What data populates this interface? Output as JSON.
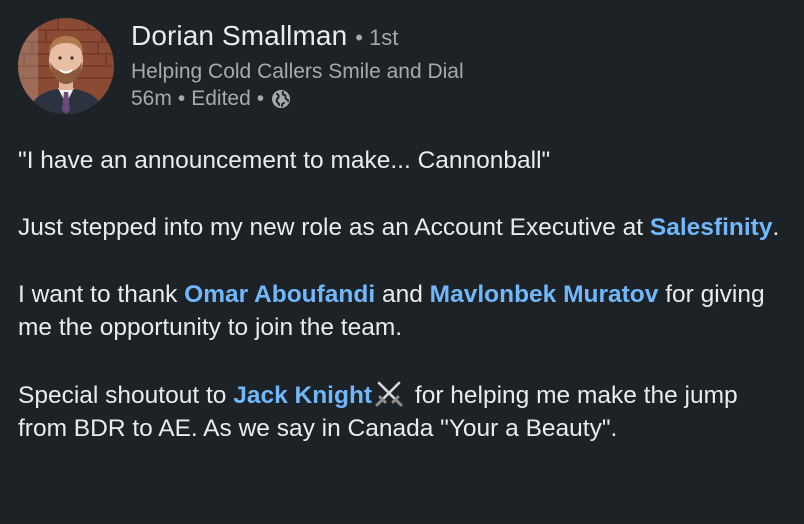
{
  "author": {
    "name": "Dorian Smallman",
    "degree": "• 1st",
    "headline": "Helping Cold Callers Smile and Dial",
    "time": "56m",
    "edited": "Edited",
    "visibility_icon": "globe-icon"
  },
  "post": {
    "p1": "\"I have an announcement to make... Cannonball\"",
    "p2_text": "Just stepped into my new role as an Account Executive at ",
    "p2_company": "Salesfinity",
    "p2_end": ".",
    "p3_text": "I want to thank ",
    "p3_mention1": "Omar Aboufandi",
    "p3_and": " and ",
    "p3_mention2": "Mavlonbek Muratov",
    "p3_end": " for giving me the opportunity to join the team.",
    "p4_text": "Special shoutout to ",
    "p4_mention": "Jack Knight",
    "p4_emoji": "crossed-swords-icon",
    "p4_end": " for helping me make the jump from BDR to AE. As we say in Canada \"Your a Beauty\"."
  },
  "colors": {
    "background": "#1d2226",
    "text": "#ebebeb",
    "muted": "#a7a9ab",
    "link": "#71b7fb"
  }
}
